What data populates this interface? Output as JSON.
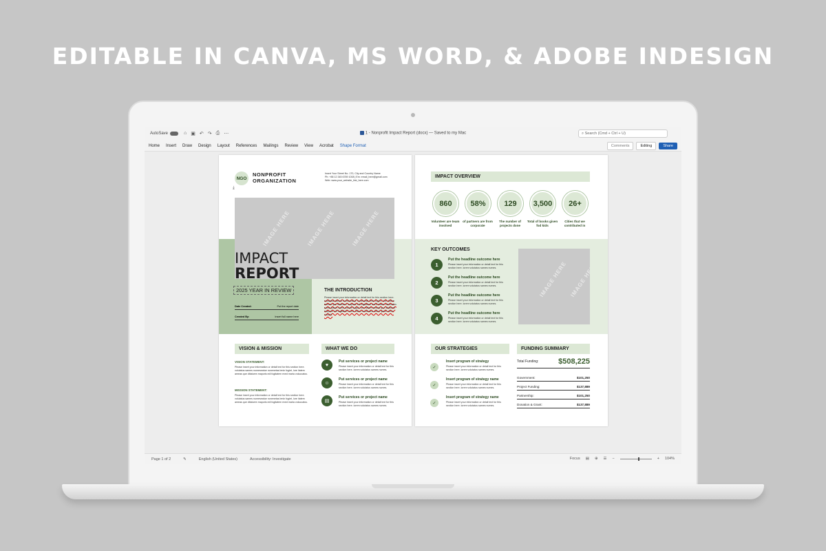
{
  "banner": "EDITABLE IN CANVA, MS WORD, & ADOBE INDESIGN",
  "word": {
    "autosave": "AutoSave",
    "doc_title": "1 - Nonprofit Impact Report (docx) — Saved to my Mac",
    "search_placeholder": "Search (Cmd + Ctrl + U)",
    "tabs": [
      "Home",
      "Insert",
      "Draw",
      "Design",
      "Layout",
      "References",
      "Mailings",
      "Review",
      "View",
      "Acrobat",
      "Shape Format"
    ],
    "comments": "Comments",
    "editing": "Editing",
    "share": "Share",
    "status": {
      "page": "Page 1 of 2",
      "language": "English (United States)",
      "accessibility": "Accessibility: Investigate",
      "focus": "Focus",
      "zoom": "104%"
    }
  },
  "doc": {
    "logo": "NGO",
    "org_line1": "NONPROFIT",
    "org_line2": "ORGANIZATION",
    "contact1": "Insert Your Street No. 170, City and Country Name",
    "contact2": "Ph: +88 12 345 6789 1008 | Em: email_here@gmail.com",
    "contact3": "Web: www.your_website_link_here.com",
    "image_here": "IMAGE HERE",
    "impact": "IMPACT",
    "report": "REPORT",
    "year_review": "2025 YEAR IN REVIEW",
    "date_label": "Date Created:",
    "date_value": "Put the report date",
    "by_label": "Created By:",
    "by_value": "Insert full name here",
    "intro_title": "THE INTRODUCTION",
    "intro_text": "Please insert your information or detail text for this section here. volutatus sames numeseatue nonenetas lenin fugiet, lore itatem ameas que ditaturen maporis edi fugitatem exed maria voluccatus sama ipsum simin voluchi fugiat. lore itatem ameas que ditaturen maporis edi fugitatem exed maria voluccatus sama ipsum simin voluchi.",
    "vision_mission": "VISION & MISSION",
    "vision_label": "VISION STATEMENT:",
    "vision_text": "Please insert your information or detail text for this section here. volutatus sames numeseatue nonenetas lenin fugiet, lore itatem ameas que ditaturen maporis edi fugitatem exed maria voluccatus.",
    "mission_label": "MISSION STATEMENT:",
    "mission_text": "Please insert your information or detail text for this section here. volutatus sames numeseatue nonenetas lenin fugiet, lore itatem ameas que ditaturen maporis edi fugitatem exed maria voluccatus.",
    "what_we_do": "WHAT WE DO",
    "services": [
      {
        "title": "Put services or project name",
        "text": "Please insert your information or detail text for this section here. lorem volutatus sames numes."
      },
      {
        "title": "Put services or project name",
        "text": "Please insert your information or detail text for this section here. lorem volutatus sames numes."
      },
      {
        "title": "Put services or project name",
        "text": "Please insert your information or detail text for this section here. lorem volutatus sames numes."
      }
    ],
    "impact_overview": "IMPACT OVERVIEW",
    "stats": [
      {
        "value": "860",
        "label": "Volunteer are team involved"
      },
      {
        "value": "58%",
        "label": "of partners are from corporate"
      },
      {
        "value": "129",
        "label": "The number of projects done"
      },
      {
        "value": "3,500",
        "label": "Total of books given fod kids"
      },
      {
        "value": "26+",
        "label": "Cities that we contributed in"
      }
    ],
    "key_outcomes": "KEY OUTCOMES",
    "outcomes": [
      {
        "num": "1",
        "title": "Put the headline outcome here",
        "text": "Please insert your information or detail text for this section here. lorem volutatus sames numes."
      },
      {
        "num": "2",
        "title": "Put the headline outcome here",
        "text": "Please insert your information or detail text for this section here. lorem volutatus sames numes."
      },
      {
        "num": "3",
        "title": "Put the headline outcome here",
        "text": "Please insert your information or detail text for this section here. lorem volutatus sames numes."
      },
      {
        "num": "4",
        "title": "Put the headline outcome here",
        "text": "Please insert your information or detail text for this section here. lorem volutatus sames numes."
      }
    ],
    "our_strategies": "OUR STRATEGIES",
    "strategies": [
      {
        "title": "Insert program of strategy",
        "text": "Please insert your information or detail text for this section here. lorem volutatus sames numes."
      },
      {
        "title": "Insert program of strategy name",
        "text": "Please insert your information or detail text for this section here. lorem volutatus sames numes."
      },
      {
        "title": "Insert program of strategy name",
        "text": "Please insert your information or detail text for this section here. lorem volutatus sames numes."
      }
    ],
    "funding_summary": "FUNDING SUMMARY",
    "total_label": "Total Funding:",
    "total_value": "$508,225",
    "funding": [
      {
        "label": "Government:",
        "value": "$101,250"
      },
      {
        "label": "Project Funding:",
        "value": "$137,889"
      },
      {
        "label": "Partnership:",
        "value": "$101,250"
      },
      {
        "label": "Donation & Grant:",
        "value": "$137,889"
      }
    ]
  },
  "colors": {
    "accent_green": "#3b5e2f",
    "light_green": "#dce8d5",
    "word_blue": "#1e5fb4"
  }
}
